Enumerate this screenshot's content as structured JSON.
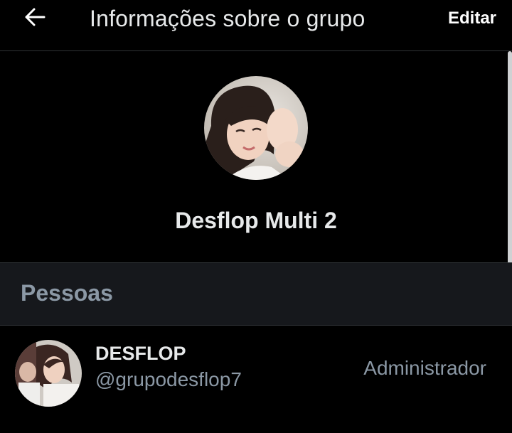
{
  "header": {
    "title": "Informações sobre o grupo",
    "edit_label": "Editar",
    "back_icon": "arrow-left-icon"
  },
  "group": {
    "name": "Desflop Multi 2"
  },
  "people_section": {
    "title": "Pessoas",
    "members": [
      {
        "name": "DESFLOP",
        "handle": "@grupodesflop7",
        "role": "Administrador"
      }
    ]
  },
  "colors": {
    "background": "#000000",
    "section_background": "#16181c",
    "divider": "#2f3336",
    "primary_text": "#e7e9ea",
    "secondary_text": "#8b98a5"
  }
}
